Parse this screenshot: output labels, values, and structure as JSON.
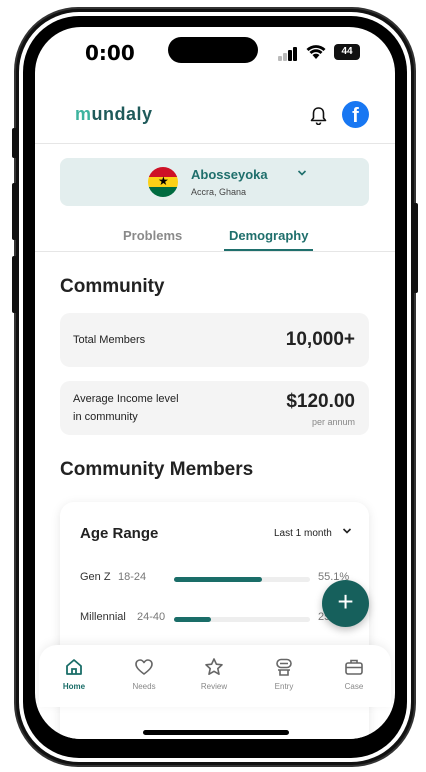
{
  "status_bar": {
    "time": "0:00",
    "battery": "44"
  },
  "header": {
    "logo": "mundaly",
    "notifications_icon": "bell-icon",
    "profile_icon": "facebook-icon",
    "profile_glyph": "f"
  },
  "location": {
    "name": "Abosseyoka",
    "subtitle": "Accra, Ghana",
    "flag": "ghana-flag"
  },
  "tabs": [
    {
      "label": "Problems",
      "active": false
    },
    {
      "label": "Demography",
      "active": true
    }
  ],
  "community": {
    "title": "Community",
    "total_members": {
      "label": "Total Members",
      "value": "10,000+"
    },
    "average_income": {
      "label_line1": "Average Income level",
      "label_line2": "in community",
      "value": "$120.00",
      "sub": "per annum"
    }
  },
  "community_members": {
    "title": "Community Members",
    "age_range": {
      "title": "Age Range",
      "filter": "Last 1 month",
      "rows": [
        {
          "name": "Gen Z",
          "range": "18-24",
          "percent_text": "55.1%",
          "fraction": 0.65
        },
        {
          "name": "Millennial",
          "range": "24-40",
          "percent_text": "25.",
          "fraction": 0.27
        }
      ]
    }
  },
  "fab": {
    "label": "+"
  },
  "bottom_nav": [
    {
      "label": "Home",
      "icon": "home-icon",
      "active": true
    },
    {
      "label": "Needs",
      "icon": "heart-icon",
      "active": false
    },
    {
      "label": "Review",
      "icon": "star-icon",
      "active": false
    },
    {
      "label": "Entry",
      "icon": "entry-icon",
      "active": false
    },
    {
      "label": "Case",
      "icon": "briefcase-icon",
      "active": false
    }
  ],
  "colors": {
    "primary": "#1a6d68",
    "facebook": "#1877f2",
    "location_bg": "#e3eeee"
  }
}
